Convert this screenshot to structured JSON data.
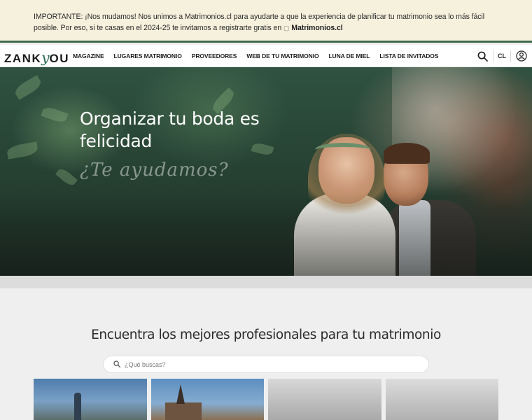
{
  "notice": {
    "prefix": "IMPORTANTE:",
    "text": " ¡Nos mudamos! Nos unimos a Matrimonios.cl para ayudarte a que la experiencia de planificar tu matrimonio sea lo más fácil posible. Por eso, si te casas en el 2024-25 te invitamos a registrarte gratis en ",
    "link_label": "Matrimonios.cl"
  },
  "navbar": {
    "logo": {
      "part1": "ZANK",
      "part2": "y",
      "part3": "OU"
    },
    "items": [
      {
        "label": "MAGAZINE"
      },
      {
        "label": "LUGARES MATRIMONIO"
      },
      {
        "label": "PROVEEDORES"
      },
      {
        "label": "WEB DE TU MATRIMONIO"
      },
      {
        "label": "LUNA DE MIEL"
      },
      {
        "label": "LISTA DE INVITADOS"
      }
    ],
    "country": "CL",
    "icons": {
      "search": "search-icon",
      "account": "user-icon"
    }
  },
  "hero": {
    "title": "Organizar tu boda es felicidad",
    "script": "¿Te ayudamos?"
  },
  "main": {
    "section_title": "Encuentra los mejores profesionales para tu matrimonio",
    "search": {
      "placeholder": "¿Qué buscas?"
    }
  },
  "colors": {
    "accent": "#3f6a4c",
    "notice_bg": "#f6f1dd",
    "page_bg": "#efefef"
  }
}
